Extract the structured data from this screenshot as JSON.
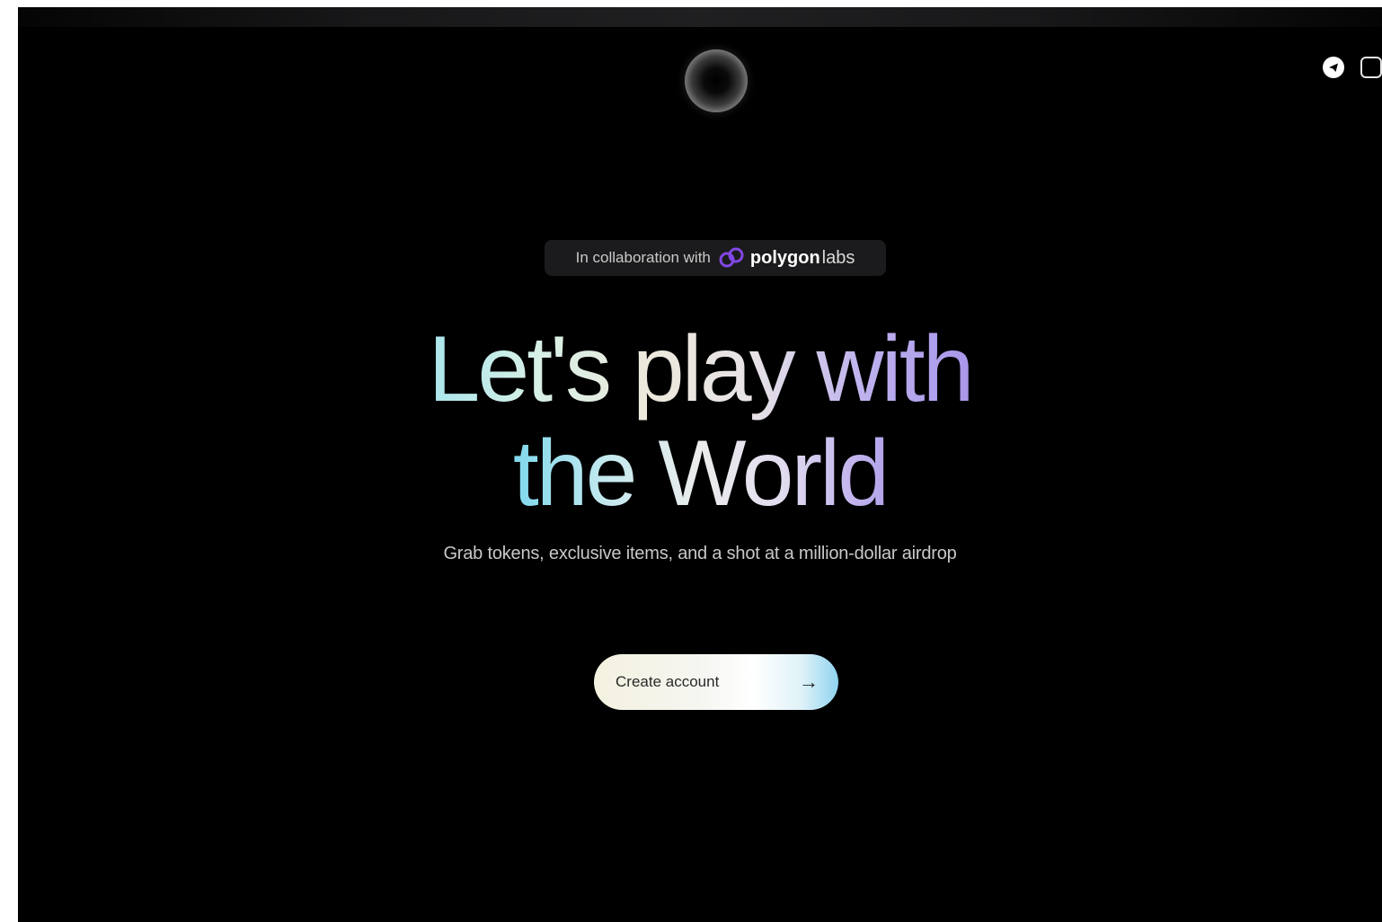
{
  "header": {
    "social_icons": [
      "telegram-icon",
      "instagram-icon"
    ]
  },
  "collab": {
    "prefix": "In collaboration with",
    "brand_name": "polygon",
    "brand_suffix": "labs",
    "brand_color": "#8247e5"
  },
  "hero": {
    "line1": "Let's play with",
    "line2": "the World",
    "subtitle": "Grab tokens, exclusive items, and a shot at a million-dollar airdrop"
  },
  "cta": {
    "label": "Create account",
    "arrow": "→"
  },
  "colors": {
    "background": "#000000",
    "gradient_teal": "#7fd8ec",
    "gradient_purple": "#a996ea"
  }
}
